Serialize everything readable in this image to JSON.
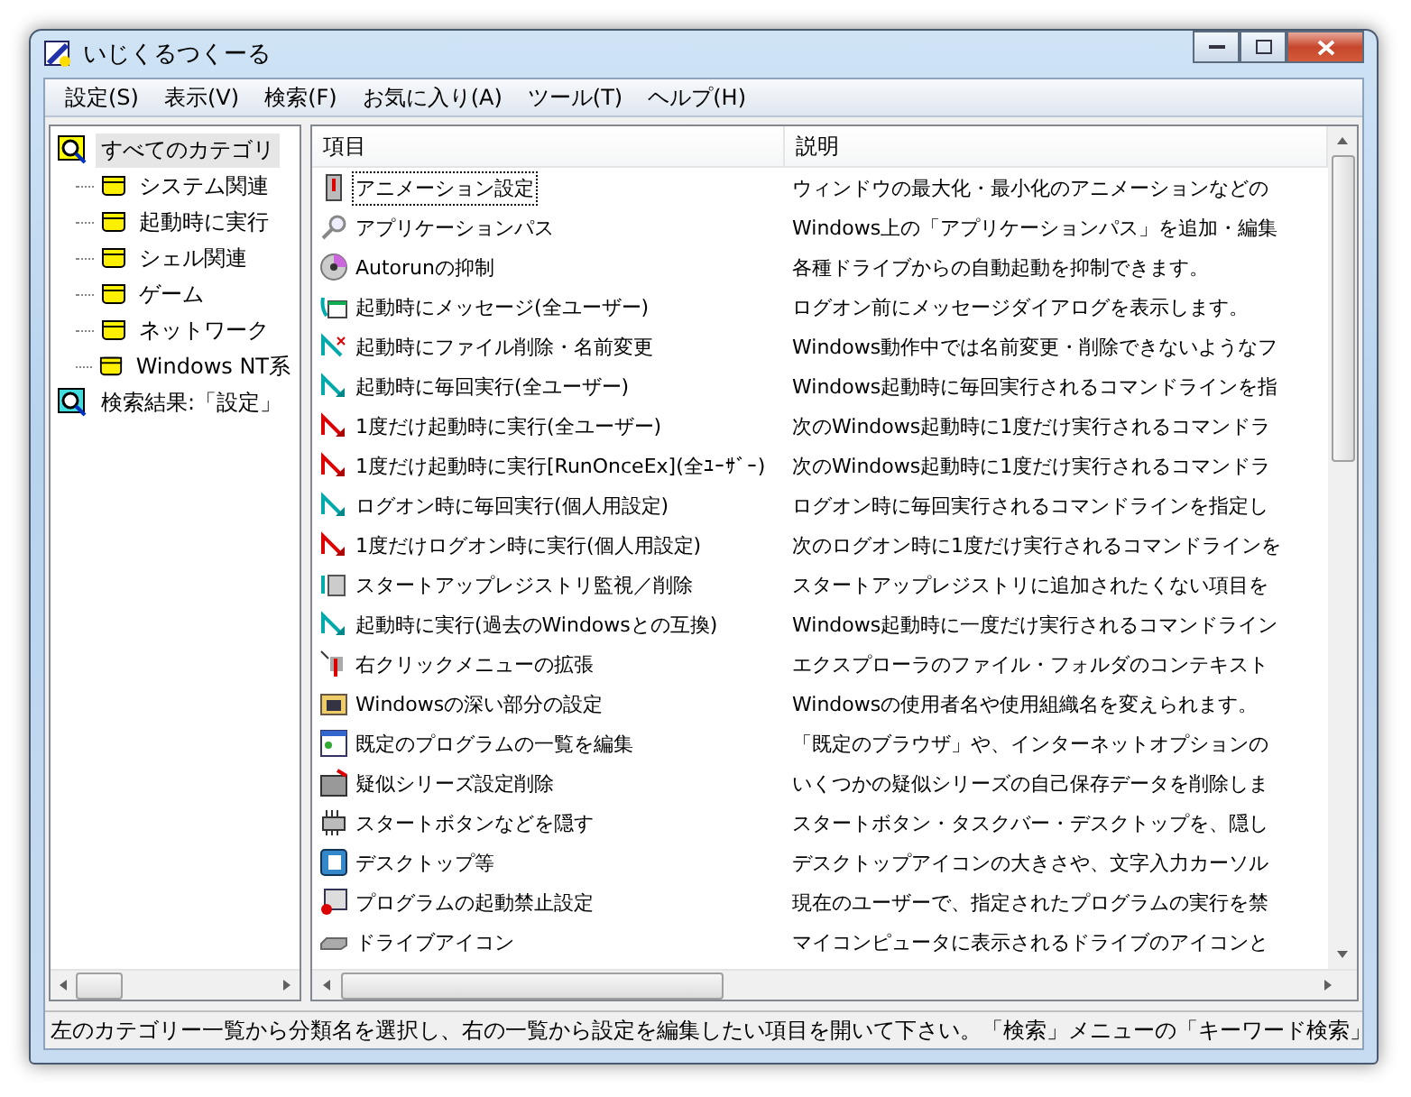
{
  "window": {
    "title": "いじくるつくーる"
  },
  "menu": [
    "設定(S)",
    "表示(V)",
    "検索(F)",
    "お気に入り(A)",
    "ツール(T)",
    "ヘルプ(H)"
  ],
  "tree": {
    "root": {
      "label": "すべてのカテゴリ",
      "selected": true,
      "children": [
        {
          "label": "システム関連",
          "selected": false
        },
        {
          "label": "起動時に実行",
          "selected": false
        },
        {
          "label": "シェル関連",
          "selected": false
        },
        {
          "label": "ゲーム",
          "selected": false
        },
        {
          "label": "ネットワーク",
          "selected": false
        },
        {
          "label": "Windows NT系",
          "selected": false
        }
      ]
    },
    "search_result": {
      "label": "検索結果:「設定」",
      "selected": false
    }
  },
  "table": {
    "columns": [
      "項目",
      "説明"
    ],
    "rows": [
      {
        "item": "アニメーション設定",
        "description": "ウィンドウの最大化・最小化のアニメーションなどの",
        "selected": true
      },
      {
        "item": "アプリケーションパス",
        "description": "Windows上の「アプリケーションパス」を追加・編集",
        "selected": false
      },
      {
        "item": "Autorunの抑制",
        "description": "各種ドライブからの自動起動を抑制できます。",
        "selected": false
      },
      {
        "item": "起動時にメッセージ(全ユーザー)",
        "description": "ログオン前にメッセージダイアログを表示します。",
        "selected": false
      },
      {
        "item": "起動時にファイル削除・名前変更",
        "description": "Windows動作中では名前変更・削除できないようなフ",
        "selected": false
      },
      {
        "item": "起動時に毎回実行(全ユーザー)",
        "description": "Windows起動時に毎回実行されるコマンドラインを指",
        "selected": false
      },
      {
        "item": "1度だけ起動時に実行(全ユーザー)",
        "description": "次のWindows起動時に1度だけ実行されるコマンドラ",
        "selected": false
      },
      {
        "item": "1度だけ起動時に実行[RunOnceEx](全ﾕｰｻﾞｰ)",
        "description": "次のWindows起動時に1度だけ実行されるコマンドラ",
        "selected": false
      },
      {
        "item": "ログオン時に毎回実行(個人用設定)",
        "description": "ログオン時に毎回実行されるコマンドラインを指定し",
        "selected": false
      },
      {
        "item": "1度だけログオン時に実行(個人用設定)",
        "description": "次のログオン時に1度だけ実行されるコマンドラインを",
        "selected": false
      },
      {
        "item": "スタートアップレジストリ監視／削除",
        "description": "スタートアップレジストリに追加されたくない項目を",
        "selected": false
      },
      {
        "item": "起動時に実行(過去のWindowsとの互換)",
        "description": "Windows起動時に一度だけ実行されるコマンドライン",
        "selected": false
      },
      {
        "item": "右クリックメニューの拡張",
        "description": "エクスプローラのファイル・フォルダのコンテキスト",
        "selected": false
      },
      {
        "item": "Windowsの深い部分の設定",
        "description": "Windowsの使用者名や使用組織名を変えられます。",
        "selected": false
      },
      {
        "item": "既定のプログラムの一覧を編集",
        "description": "「既定のブラウザ」や、インターネットオプションの",
        "selected": false
      },
      {
        "item": "疑似シリーズ設定削除",
        "description": "いくつかの疑似シリーズの自己保存データを削除しま",
        "selected": false
      },
      {
        "item": "スタートボタンなどを隠す",
        "description": "スタートボタン・タスクバー・デスクトップを、隠し",
        "selected": false
      },
      {
        "item": "デスクトップ等",
        "description": "デスクトップアイコンの大きさや、文字入力カーソル",
        "selected": false
      },
      {
        "item": "プログラムの起動禁止設定",
        "description": "現在のユーザーで、指定されたプログラムの実行を禁",
        "selected": false
      },
      {
        "item": "ドライブアイコン",
        "description": "マイコンピュータに表示されるドライブのアイコンと",
        "selected": false
      }
    ]
  },
  "status_bar": "左のカテゴリー一覧から分類名を選択し、右の一覧から設定を編集したい項目を開いて下さい。「検索」メニューの「キーワード検索」"
}
